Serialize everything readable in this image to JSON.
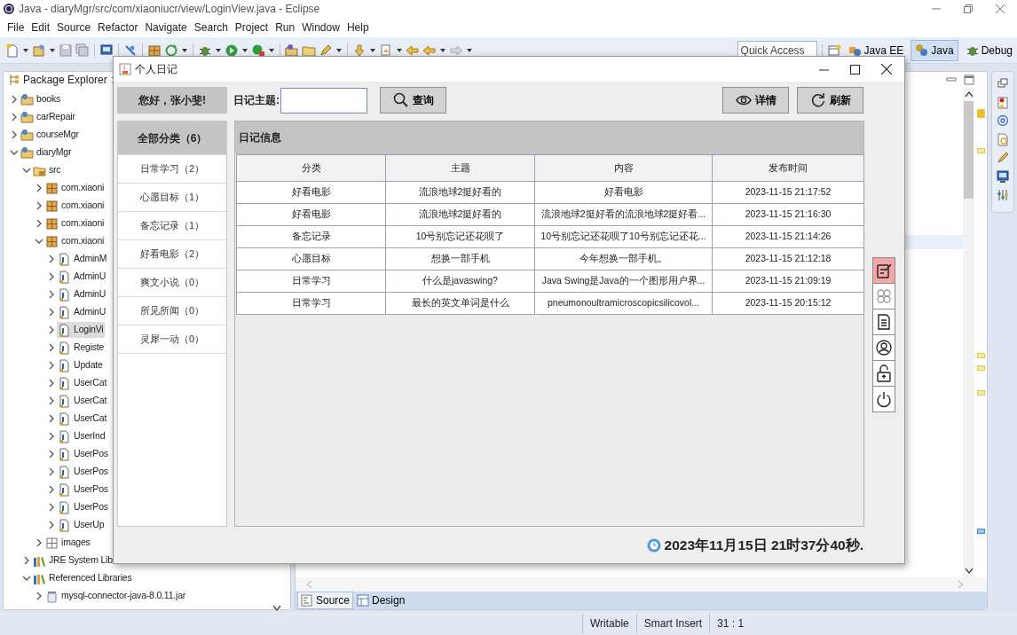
{
  "window": {
    "title": "Java - diaryMgr/src/com/xiaoniucr/view/LoginView.java - Eclipse"
  },
  "menu": [
    "File",
    "Edit",
    "Source",
    "Refactor",
    "Navigate",
    "Search",
    "Project",
    "Run",
    "Window",
    "Help"
  ],
  "toolbar": {
    "quick_access": {
      "placeholder": "Quick Access"
    },
    "perspectives": [
      {
        "label": "Java EE",
        "selected": false
      },
      {
        "label": "Java",
        "selected": true
      },
      {
        "label": "Debug",
        "selected": false
      }
    ]
  },
  "package_explorer": {
    "title": "Package Explorer",
    "tree": [
      {
        "label": "books",
        "kind": "project",
        "expanded": false,
        "selected": false
      },
      {
        "label": "carRepair",
        "kind": "project",
        "expanded": false,
        "selected": false
      },
      {
        "label": "courseMgr",
        "kind": "project",
        "expanded": false,
        "selected": false
      },
      {
        "label": "diaryMgr",
        "kind": "project",
        "expanded": true,
        "selected": false,
        "children": [
          {
            "label": "src",
            "kind": "source-folder",
            "expanded": true,
            "selected": false,
            "children": [
              {
                "label": "com.xiaoni",
                "kind": "package",
                "expanded": false,
                "selected": false
              },
              {
                "label": "com.xiaoni",
                "kind": "package",
                "expanded": false,
                "selected": false
              },
              {
                "label": "com.xiaoni",
                "kind": "package",
                "expanded": false,
                "selected": false
              },
              {
                "label": "com.xiaoni",
                "kind": "package",
                "expanded": true,
                "selected": false,
                "children": [
                  {
                    "label": "AdminM",
                    "kind": "java-file",
                    "expanded": false,
                    "selected": false
                  },
                  {
                    "label": "AdminU",
                    "kind": "java-file",
                    "expanded": false,
                    "selected": false
                  },
                  {
                    "label": "AdminU",
                    "kind": "java-file",
                    "expanded": false,
                    "selected": false
                  },
                  {
                    "label": "AdminU",
                    "kind": "java-file",
                    "expanded": false,
                    "selected": false
                  },
                  {
                    "label": "LoginVi",
                    "kind": "java-file",
                    "expanded": false,
                    "selected": true
                  },
                  {
                    "label": "Registe",
                    "kind": "java-file",
                    "expanded": false,
                    "selected": false
                  },
                  {
                    "label": "Update",
                    "kind": "java-file",
                    "expanded": false,
                    "selected": false
                  },
                  {
                    "label": "UserCat",
                    "kind": "java-file",
                    "expanded": false,
                    "selected": false
                  },
                  {
                    "label": "UserCat",
                    "kind": "java-file",
                    "expanded": false,
                    "selected": false
                  },
                  {
                    "label": "UserCat",
                    "kind": "java-file",
                    "expanded": false,
                    "selected": false
                  },
                  {
                    "label": "UserInd",
                    "kind": "java-file",
                    "expanded": false,
                    "selected": false
                  },
                  {
                    "label": "UserPos",
                    "kind": "java-file",
                    "expanded": false,
                    "selected": false
                  },
                  {
                    "label": "UserPos",
                    "kind": "java-file",
                    "expanded": false,
                    "selected": false
                  },
                  {
                    "label": "UserPos",
                    "kind": "java-file",
                    "expanded": false,
                    "selected": false
                  },
                  {
                    "label": "UserPos",
                    "kind": "java-file",
                    "expanded": false,
                    "selected": false
                  },
                  {
                    "label": "UserUp",
                    "kind": "java-file",
                    "expanded": false,
                    "selected": false
                  }
                ]
              },
              {
                "label": "images",
                "kind": "empty-package",
                "expanded": false,
                "selected": false
              }
            ]
          },
          {
            "label": "JRE System Lib",
            "kind": "library",
            "expanded": false,
            "selected": false
          },
          {
            "label": "Referenced Libraries",
            "kind": "library",
            "expanded": true,
            "selected": false,
            "children": [
              {
                "label": "mysql-connector-java-8.0.11.jar",
                "kind": "jar",
                "expanded": false,
                "selected": false
              }
            ]
          }
        ]
      }
    ]
  },
  "dialog": {
    "title": "个人日记",
    "greeting": "您好，张小斐!",
    "search": {
      "label": "日记主题:",
      "button": {
        "label": "查询",
        "kind": "search"
      }
    },
    "actions": [
      {
        "label": "详情",
        "kind": "view"
      },
      {
        "label": "刷新",
        "kind": "refresh"
      }
    ],
    "categories": [
      {
        "label": "全部分类（6）",
        "selected": true
      },
      {
        "label": "日常学习（2）",
        "selected": false
      },
      {
        "label": "心愿目标（1）",
        "selected": false
      },
      {
        "label": "备忘记录（1）",
        "selected": false
      },
      {
        "label": "好看电影（2）",
        "selected": false
      },
      {
        "label": "爽文小说（0）",
        "selected": false
      },
      {
        "label": "所见所闻（0）",
        "selected": false
      },
      {
        "label": "灵犀一动（0）",
        "selected": false
      }
    ],
    "panel_title": "日记信息",
    "table": {
      "columns": [
        "分类",
        "主题",
        "内容",
        "发布时间"
      ],
      "rows": [
        [
          "好看电影",
          "流浪地球2挺好看的",
          "好看电影",
          "2023-11-15 21:17:52"
        ],
        [
          "好看电影",
          "流浪地球2挺好看的",
          "流浪地球2挺好看的流浪地球2挺好看...",
          "2023-11-15 21:16:30"
        ],
        [
          "备忘记录",
          "10号别忘记还花呗了",
          "10号别忘记还花呗了10号别忘记还花...",
          "2023-11-15 21:14:26"
        ],
        [
          "心愿目标",
          "想换一部手机",
          "今年想换一部手机。",
          "2023-11-15 21:12:18"
        ],
        [
          "日常学习",
          "什么是javaswing?",
          "Java Swing是Java的一个图形用户界...",
          "2023-11-15 21:09:19"
        ],
        [
          "日常学习",
          "最长的英文单词是什么",
          "pneumonoultramicroscopicsilicovol...",
          "2023-11-15 20:15:12"
        ]
      ]
    },
    "side_buttons": [
      {
        "kind": "edit",
        "selected": true
      },
      {
        "kind": "grid",
        "selected": false
      },
      {
        "kind": "document",
        "selected": false
      },
      {
        "kind": "user",
        "selected": false
      },
      {
        "kind": "unlock",
        "selected": false
      },
      {
        "kind": "power",
        "selected": false
      }
    ],
    "clock": "2023年11月15日 21时37分40秒."
  },
  "editor": {
    "tabs": [
      {
        "label": "Source",
        "selected": true
      },
      {
        "label": "Design",
        "selected": false
      }
    ]
  },
  "status_bar": [
    "Writable",
    "Smart Insert",
    "31 : 1"
  ]
}
